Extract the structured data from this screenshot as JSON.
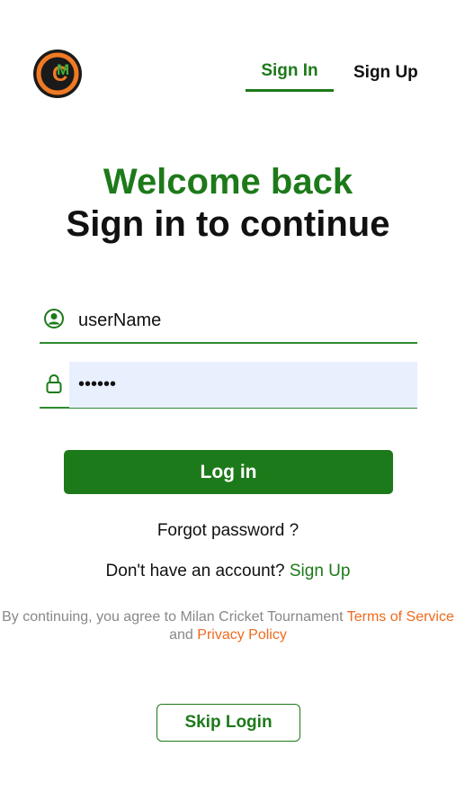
{
  "logo": {
    "icon": "milan-cricket-logo-icon",
    "letter_c": "C",
    "letter_m": "M"
  },
  "tabs": {
    "signin": "Sign In",
    "signup": "Sign Up"
  },
  "header": {
    "welcome": "Welcome back",
    "subtitle": "Sign in to continue"
  },
  "form": {
    "username_value": "userName",
    "password_value": "••••••",
    "user_icon": "user-circle-icon",
    "lock_icon": "lock-icon"
  },
  "buttons": {
    "login": "Log in",
    "skip": "Skip Login"
  },
  "links": {
    "forgot": "Forgot password ?",
    "no_account": "Don't have an account?",
    "signup": "Sign Up"
  },
  "terms": {
    "prefix": "By continuing, you agree to Milan Cricket Tournament",
    "tos": "Terms of Service",
    "and": "and",
    "privacy": "Privacy Policy"
  },
  "colors": {
    "primary_green": "#1d7a1a",
    "accent_orange": "#ee6a1e",
    "logo_ring": "#f07a24"
  }
}
